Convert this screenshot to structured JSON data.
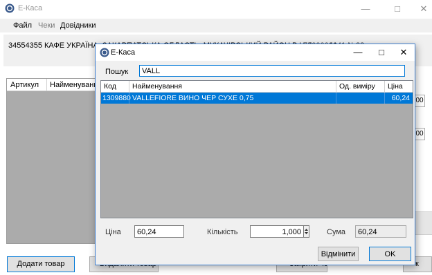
{
  "main_window": {
    "title": "E-Каса",
    "menu": [
      "Файл",
      "Чеки",
      "Довідники"
    ],
    "shop_info_visible": "34554355 КАФЕ УКРАЇНА, ЗАКАРПАТСЬКА ОБЛАСТЬ, МУКАЧІВСЬКИЙ РАЙОН В.Н.Лучки 11",
    "shop_info_tail": "7000000041  №38",
    "table_columns": [
      "Артикул",
      "Найменування"
    ],
    "side_stub_values": [
      "00",
      "00"
    ],
    "buttons": {
      "add_item": "Додати товар",
      "delete_item": "Видалити товар",
      "check": "Закрити чек",
      "ok_partial": "к"
    }
  },
  "dialog": {
    "title": "E-Каса",
    "search": {
      "label": "Пошук",
      "value": "VALL"
    },
    "columns": [
      "Код",
      "Найменування",
      "Од. виміру",
      "Ціна"
    ],
    "rows": [
      {
        "code": "1309880",
        "name": "VALLEFIORE ВИНО ЧЕР СУХЕ 0,75",
        "unit": "",
        "price": "60,24",
        "selected": true
      }
    ],
    "price_label": "Ціна",
    "price_value": "60,24",
    "qty_label": "Кількість",
    "qty_value": "1,000",
    "sum_label": "Сума",
    "sum_value": "60,24",
    "cancel_button": "Відмінити",
    "ok_button": "OK"
  },
  "colors": {
    "selection": "#0078d7",
    "grid_empty": "#ababab",
    "window_bg": "#f0f0f0"
  }
}
